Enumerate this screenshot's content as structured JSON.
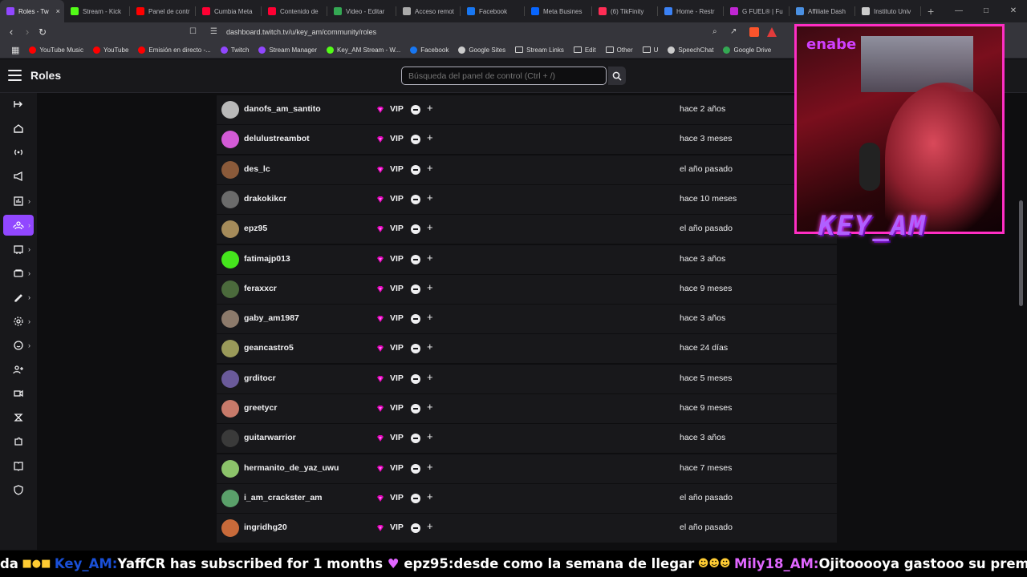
{
  "browser": {
    "tabs": [
      {
        "label": "Roles - Tw",
        "color": "#9147ff",
        "active": true
      },
      {
        "label": "Stream - Kick",
        "color": "#53fc18"
      },
      {
        "label": "Panel de contr",
        "color": "#ff0000"
      },
      {
        "label": "Cumbia Meta",
        "color": "#ff0033"
      },
      {
        "label": "Contenido de",
        "color": "#ff0033"
      },
      {
        "label": "Video - Editar",
        "color": "#34a853"
      },
      {
        "label": "Acceso remot",
        "color": "#aaaaaa"
      },
      {
        "label": "Facebook",
        "color": "#1877f2"
      },
      {
        "label": "Meta Busines",
        "color": "#0866ff"
      },
      {
        "label": "(6) TikFinity",
        "color": "#ff2d55"
      },
      {
        "label": "Home - Restr",
        "color": "#3b82f6"
      },
      {
        "label": "G FUEL® | Fu",
        "color": "#c026d3"
      },
      {
        "label": "Affiliate Dash",
        "color": "#4a90e2"
      },
      {
        "label": "Instituto Univ",
        "color": "#cccccc"
      }
    ],
    "url": "dashboard.twitch.tv/u/key_am/community/roles",
    "bookmarks": [
      {
        "label": "YouTube Music",
        "color": "#ff0000"
      },
      {
        "label": "YouTube",
        "color": "#ff0000"
      },
      {
        "label": "Emisión en directo -...",
        "color": "#ff0000"
      },
      {
        "label": "Twitch",
        "color": "#9147ff"
      },
      {
        "label": "Stream Manager",
        "color": "#9147ff"
      },
      {
        "label": "Key_AM Stream - W...",
        "color": "#53fc18"
      },
      {
        "label": "Facebook",
        "color": "#1877f2"
      },
      {
        "label": "Google Sites",
        "color": "#cccccc"
      },
      {
        "label": "Stream Links",
        "color": "folder"
      },
      {
        "label": "Edit",
        "color": "folder"
      },
      {
        "label": "Other",
        "color": "folder"
      },
      {
        "label": "U",
        "color": "folder"
      },
      {
        "label": "SpeechChat",
        "color": "#cccccc"
      },
      {
        "label": "Google Drive",
        "color": "#34a853"
      }
    ]
  },
  "header": {
    "title": "Roles",
    "search_placeholder": "Búsqueda del panel de control (Ctrl + /)"
  },
  "rail": {
    "items": [
      "collapse",
      "home",
      "broadcast",
      "promote",
      "analytics",
      "community",
      "content",
      "monetization",
      "creator-tools",
      "settings",
      "viewer-rewards",
      "add-user",
      "video",
      "extensions",
      "puzzle",
      "book",
      "safety"
    ],
    "active_index": 5
  },
  "roles_table": {
    "role_label": "VIP",
    "rows": [
      {
        "username": "danofs_am_santito",
        "date": "hace 2 años",
        "avatar": "#b9b9b9"
      },
      {
        "username": "delulustreambot",
        "date": "hace 3 meses",
        "avatar": "#d35ad6"
      },
      {
        "username": "des_lc",
        "date": "el año pasado",
        "avatar": "#8a5a3a"
      },
      {
        "username": "drakokikcr",
        "date": "hace 10 meses",
        "avatar": "#6b6b6b"
      },
      {
        "username": "epz95",
        "date": "el año pasado",
        "avatar": "#a58b5a"
      },
      {
        "username": "fatimajp013",
        "date": "hace 3 años",
        "avatar": "#45e51d"
      },
      {
        "username": "feraxxcr",
        "date": "hace 9 meses",
        "avatar": "#4b6a3c"
      },
      {
        "username": "gaby_am1987",
        "date": "hace 3 años",
        "avatar": "#8c7a6b"
      },
      {
        "username": "geancastro5",
        "date": "hace 24 días",
        "avatar": "#9a9a5a"
      },
      {
        "username": "grditocr",
        "date": "hace 5 meses",
        "avatar": "#6a5a9a"
      },
      {
        "username": "greetycr",
        "date": "hace 9 meses",
        "avatar": "#c77a6a"
      },
      {
        "username": "guitarwarrior",
        "date": "hace 3 años",
        "avatar": "#3a3a3a"
      },
      {
        "username": "hermanito_de_yaz_uwu",
        "date": "hace 7 meses",
        "avatar": "#8cc36a"
      },
      {
        "username": "i_am_crackster_am",
        "date": "el año pasado",
        "avatar": "#5aa06a"
      },
      {
        "username": "ingridhg20",
        "date": "el año pasado",
        "avatar": "#c86a3a"
      }
    ]
  },
  "overlay": {
    "logo": "enabe",
    "name": "KEY_AM"
  },
  "ticker": {
    "lead": "da",
    "sender1": "Key_AM:",
    "msg1": "YaffCR has subscribed for 1 months",
    "sender2": "epz95:",
    "msg2": "desde como la semana de llegar",
    "sender3": "Mily18_AM:",
    "msg3": "Ojitooooya gastooo su premio"
  }
}
